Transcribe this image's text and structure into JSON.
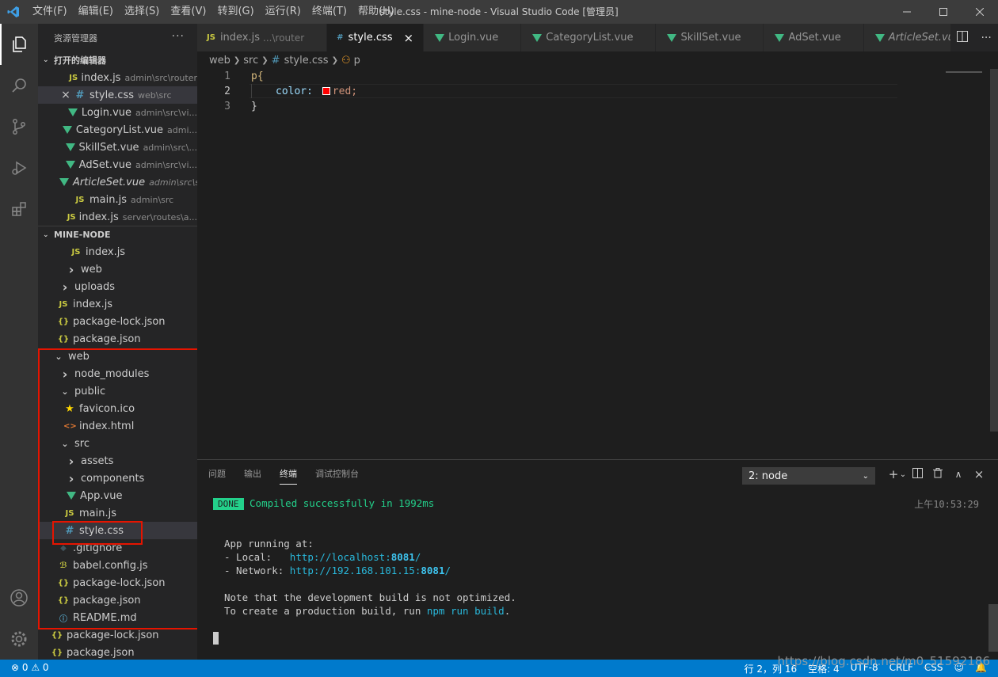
{
  "window": {
    "title": "style.css - mine-node - Visual Studio Code [管理员]"
  },
  "menu": [
    "文件(F)",
    "编辑(E)",
    "选择(S)",
    "查看(V)",
    "转到(G)",
    "运行(R)",
    "终端(T)",
    "帮助(H)"
  ],
  "sidebar": {
    "header": "资源管理器",
    "open_editors_title": "打开的编辑器",
    "open_editors": [
      {
        "icon": "js",
        "name": "index.js",
        "desc": "admin\\src\\router",
        "active": false
      },
      {
        "icon": "css",
        "name": "style.css",
        "desc": "web\\src",
        "active": true
      },
      {
        "icon": "vue",
        "name": "Login.vue",
        "desc": "admin\\src\\vi..."
      },
      {
        "icon": "vue",
        "name": "CategoryList.vue",
        "desc": "admi..."
      },
      {
        "icon": "vue",
        "name": "SkillSet.vue",
        "desc": "admin\\src\\..."
      },
      {
        "icon": "vue",
        "name": "AdSet.vue",
        "desc": "admin\\src\\vi..."
      },
      {
        "icon": "vue",
        "name": "ArticleSet.vue",
        "desc": "admin\\src\\sr...",
        "italic": true
      },
      {
        "icon": "js",
        "name": "main.js",
        "desc": "admin\\src"
      },
      {
        "icon": "js",
        "name": "index.js",
        "desc": "server\\routes\\a..."
      }
    ],
    "project_title": "MINE-NODE",
    "tree": [
      {
        "icon": "js",
        "name": "index.js",
        "indent": 40
      },
      {
        "icon": "chev",
        "name": "web",
        "indent": 34
      },
      {
        "icon": "chev",
        "name": "uploads",
        "indent": 26
      },
      {
        "icon": "js",
        "name": "index.js",
        "indent": 24
      },
      {
        "icon": "json",
        "name": "package-lock.json",
        "indent": 24
      },
      {
        "icon": "json",
        "name": "package.json",
        "indent": 24
      },
      {
        "icon": "chevd",
        "name": "web",
        "indent": 18
      },
      {
        "icon": "chev",
        "name": "node_modules",
        "indent": 26
      },
      {
        "icon": "chevd",
        "name": "public",
        "indent": 26
      },
      {
        "icon": "star",
        "name": "favicon.ico",
        "indent": 32
      },
      {
        "icon": "html",
        "name": "index.html",
        "indent": 32
      },
      {
        "icon": "chevd",
        "name": "src",
        "indent": 26
      },
      {
        "icon": "chev",
        "name": "assets",
        "indent": 34
      },
      {
        "icon": "chev",
        "name": "components",
        "indent": 34
      },
      {
        "icon": "vue",
        "name": "App.vue",
        "indent": 34
      },
      {
        "icon": "js",
        "name": "main.js",
        "indent": 32
      },
      {
        "icon": "css",
        "name": "style.css",
        "indent": 32,
        "selected": true
      },
      {
        "icon": "git",
        "name": ".gitignore",
        "indent": 24
      },
      {
        "icon": "babel",
        "name": "babel.config.js",
        "indent": 24
      },
      {
        "icon": "json",
        "name": "package-lock.json",
        "indent": 24
      },
      {
        "icon": "json",
        "name": "package.json",
        "indent": 24
      },
      {
        "icon": "md",
        "name": "README.md",
        "indent": 24
      },
      {
        "icon": "json",
        "name": "package-lock.json",
        "indent": 16
      },
      {
        "icon": "json",
        "name": "package.json",
        "indent": 16
      }
    ]
  },
  "tabs": [
    {
      "icon": "js",
      "name": "index.js",
      "desc": "...\\router"
    },
    {
      "icon": "css",
      "name": "style.css",
      "active": true,
      "close": "×"
    },
    {
      "icon": "vue",
      "name": "Login.vue"
    },
    {
      "icon": "vue",
      "name": "CategoryList.vue"
    },
    {
      "icon": "vue",
      "name": "SkillSet.vue"
    },
    {
      "icon": "vue",
      "name": "AdSet.vue"
    },
    {
      "icon": "vue",
      "name": "ArticleSet.vue",
      "italic": true
    }
  ],
  "breadcrumb": [
    "web",
    "src",
    "style.css",
    "p"
  ],
  "editor": {
    "lines": [
      {
        "num": "1",
        "text": "p{"
      },
      {
        "num": "2",
        "prop": "color:",
        "value": "red;"
      },
      {
        "num": "3",
        "text": "}"
      }
    ]
  },
  "panel": {
    "tabs": [
      "问题",
      "输出",
      "终端",
      "调试控制台"
    ],
    "active_tab": "终端",
    "terminal_select": "2: node",
    "done_badge": "DONE",
    "compiled": "Compiled successfully in 1992ms",
    "timestamp": "上午10:53:29",
    "running": "App running at:",
    "local_label": "- Local:   ",
    "local_url_a": "http://localhost:",
    "local_url_b": "8081",
    "local_url_c": "/",
    "network_label": "- Network: ",
    "network_url_a": "http://192.168.101.15:",
    "network_url_b": "8081",
    "network_url_c": "/",
    "note1": "Note that the development build is not optimized.",
    "note2a": "To create a production build, run ",
    "note2b": "npm run build",
    "note2c": "."
  },
  "status": {
    "problems": "⊗ 0 ⚠ 0",
    "position": "行 2，列 16",
    "spaces": "空格: 4",
    "encoding": "UTF-8",
    "eol": "CRLF",
    "language": "CSS"
  },
  "watermark": "https://blog.csdn.net/m0_51592186"
}
